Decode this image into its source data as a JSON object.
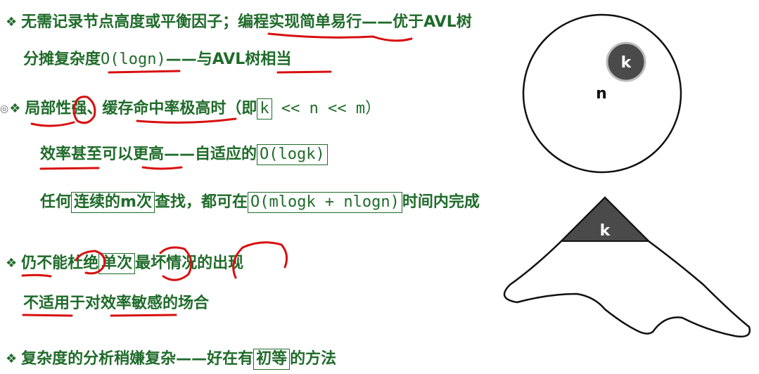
{
  "lines": {
    "l1": {
      "bullet": "❖",
      "text": "无需记录节点高度或平衡因子；编程实现简单易行——优于AVL树"
    },
    "l2": {
      "a": "分摊复杂度",
      "b": "O(logn)",
      "c": "——与AVL树相当"
    },
    "l3": {
      "prefix": "◎",
      "bullet": "❖",
      "a": "局部性强、缓存命中率极高时（即",
      "k": "k",
      "b": " << n << m）"
    },
    "l4": {
      "a": "效率甚至可以更高——自适应的",
      "b": "O(logk)"
    },
    "l5": {
      "a": "任何",
      "b": "连续的m次",
      "c": "查找，都可在",
      "d": "O(mlogk + nlogn)",
      "e": "时间内完成"
    },
    "l6": {
      "bullet": "❖",
      "a": "仍不能杜绝",
      "b": "单次",
      "c": "最坏情况的出现"
    },
    "l7": {
      "a": "不适用于对效率敏感的场合"
    },
    "l8": {
      "bullet": "❖",
      "a": "复杂度的分析稍嫌复杂——好在有",
      "b": "初等",
      "c": "的方法"
    }
  },
  "diagram": {
    "circle_outer_label": "n",
    "circle_inner_label": "k",
    "triangle_label": "k",
    "colors": {
      "inner": "#4a4a4a",
      "outline": "#111111",
      "ink": "#d81010"
    }
  }
}
